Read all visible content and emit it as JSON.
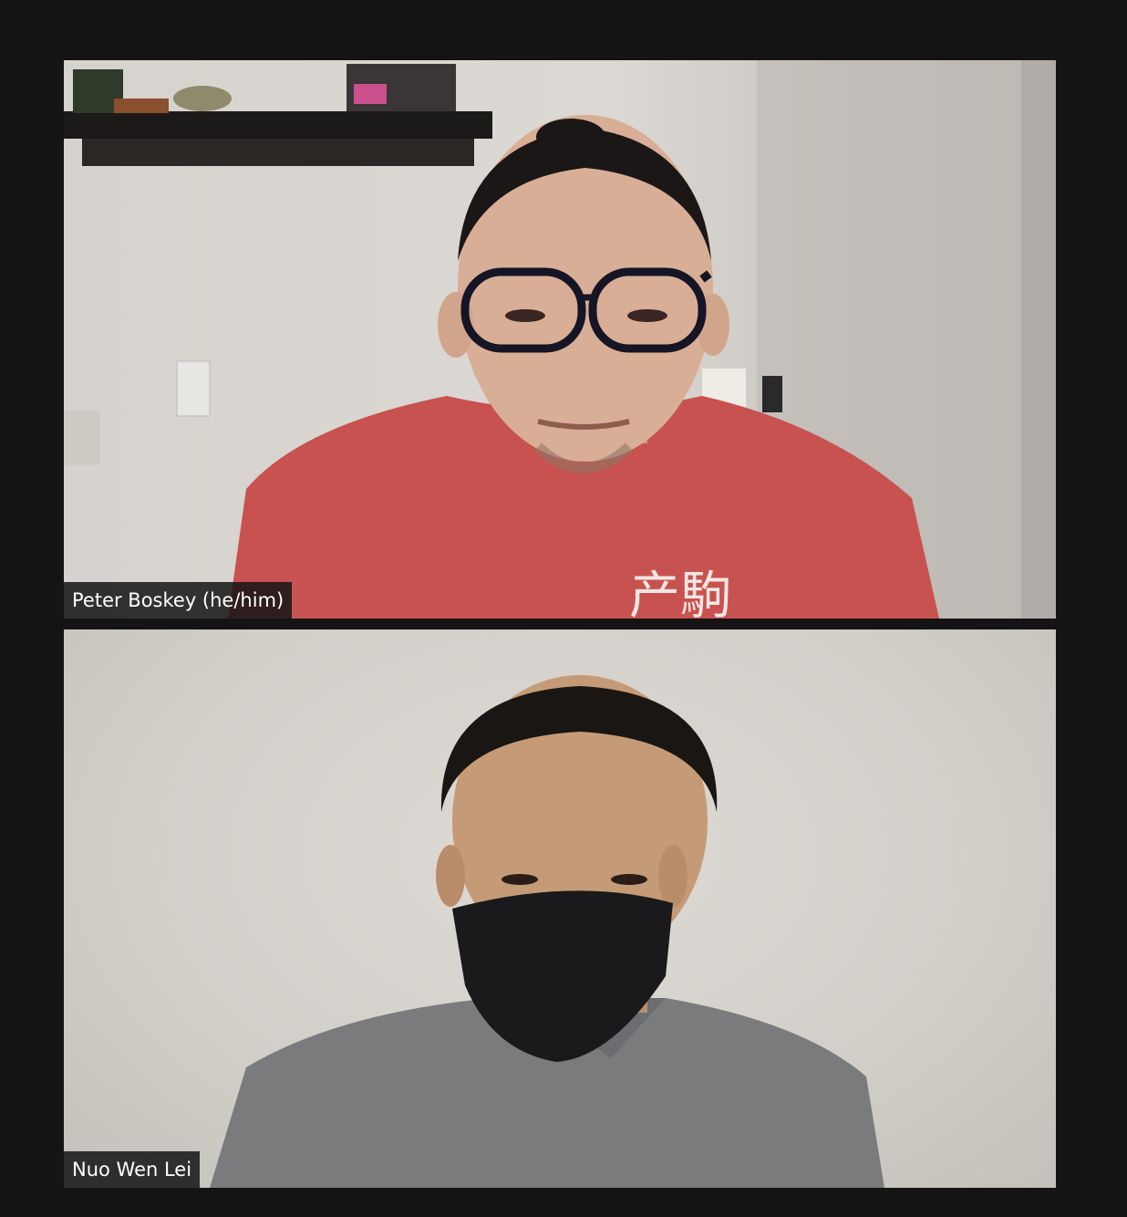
{
  "participants": [
    {
      "name": "Peter Boskey (he/him)"
    },
    {
      "name": "Nuo Wen Lei"
    }
  ]
}
